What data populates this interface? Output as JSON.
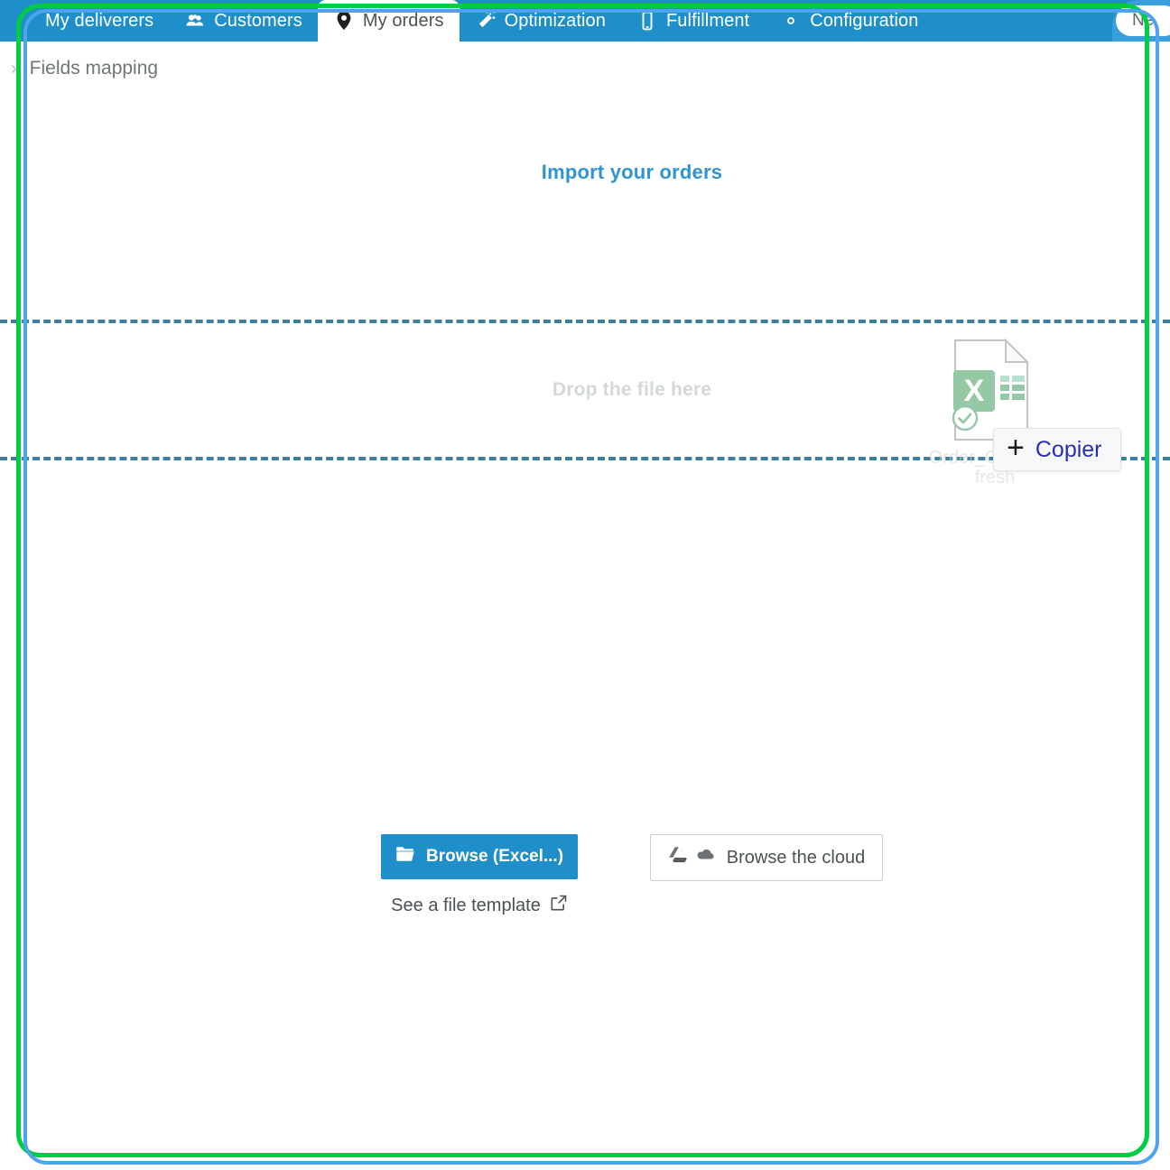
{
  "window": {
    "outer_border_color": "#00cc44",
    "inner_border_color": "#4da3ec"
  },
  "topnav": {
    "background_color": "#1f8fc9",
    "active_tab_text_color": "#4a5255",
    "tabs": [
      {
        "label": "My deliverers",
        "icon": "truck-icon",
        "active": false
      },
      {
        "label": "Customers",
        "icon": "people-icon",
        "active": false
      },
      {
        "label": "My orders",
        "icon": "location-pin-icon",
        "active": true
      },
      {
        "label": "Optimization",
        "icon": "magic-wand-icon",
        "active": false
      },
      {
        "label": "Fulfillment",
        "icon": "mobile-phone-icon",
        "active": false
      },
      {
        "label": "Configuration",
        "icon": "gear-icon",
        "active": false
      }
    ],
    "right_pill_label": "Ne"
  },
  "content": {
    "fields_mapping_label": "Fields mapping",
    "fields_mapping_chevron": "›",
    "import_title": "Import your orders",
    "import_title_color": "#2f93d4",
    "dropzone": {
      "placeholder": "Drop the file here",
      "dash_color": "#3d7f9e"
    }
  },
  "drag": {
    "file_name": "Order_Carrefour fresh",
    "file_type_icon": "excel-file-icon",
    "badge_letter": "X",
    "badge_color": "#3f9c5b",
    "status_icon": "check-circle-icon",
    "drop_action_label": "Copier",
    "drop_action_symbol": "+",
    "drop_action_color": "#2a2fb0"
  },
  "actions": {
    "browse_label": "Browse (Excel...)",
    "browse_icon": "folder-open-icon",
    "browse_bg_color": "#1f8fc9",
    "template_link_label": "See a file template",
    "template_link_icon": "external-link-icon",
    "cloud_label": "Browse the cloud",
    "cloud_icons": [
      "google-drive-icon",
      "cloud-icon"
    ]
  }
}
